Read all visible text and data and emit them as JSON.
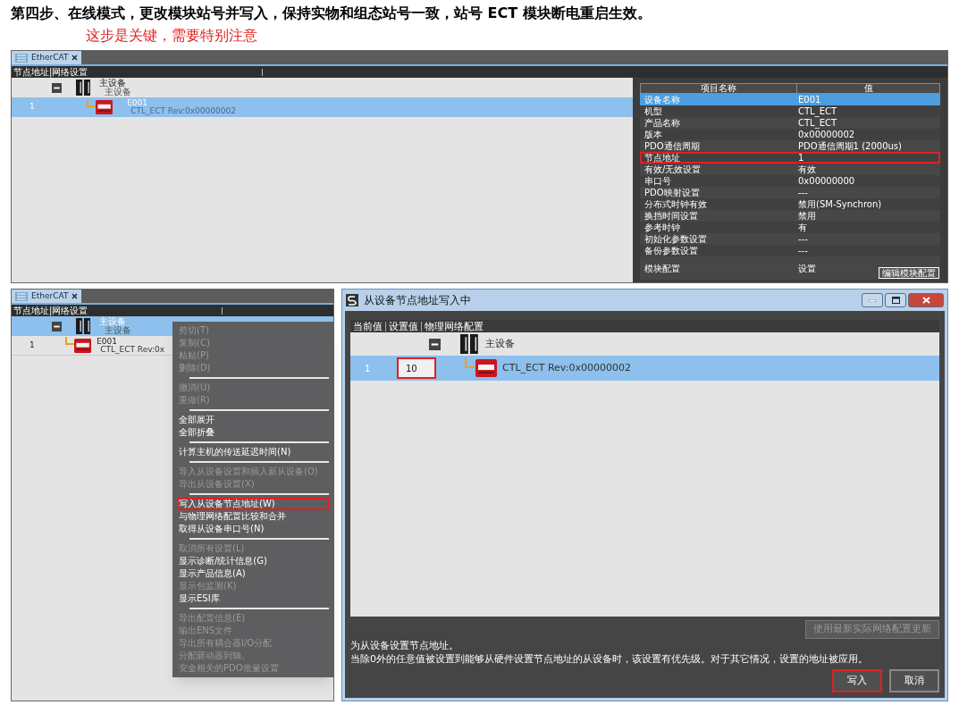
{
  "heading": {
    "title": "第四步、在线模式，更改模块站号并写入，保持实物和组态站号一致，站号 ECT 模块断电重启生效。",
    "note": "这步是关键，需要特别注意"
  },
  "top_screen": {
    "tab": "EtherCAT",
    "header": "节点地址|网络设置",
    "master": {
      "name": "主设备",
      "subtitle": "主设备",
      "selected": false
    },
    "slave": {
      "number": "1",
      "name": "E001",
      "model": "CTL_ECT Rev:0x00000002",
      "selected": true
    },
    "properties": {
      "columns": [
        "项目名称",
        "值"
      ],
      "rows": [
        {
          "name": "设备名称",
          "value": "E001",
          "selected": true,
          "marked": false
        },
        {
          "name": "机型",
          "value": "CTL_ECT",
          "selected": false,
          "marked": false
        },
        {
          "name": "产品名称",
          "value": "CTL_ECT",
          "selected": false,
          "marked": false
        },
        {
          "name": "版本",
          "value": "0x00000002",
          "selected": false,
          "marked": false
        },
        {
          "name": "PDO通信周期",
          "value": "PDO通信周期1 (2000us)",
          "selected": false,
          "marked": false
        },
        {
          "name": "节点地址",
          "value": "1",
          "selected": false,
          "marked": true
        },
        {
          "name": "有效/无效设置",
          "value": "有效",
          "selected": false,
          "marked": false
        },
        {
          "name": "串口号",
          "value": "0x00000000",
          "selected": false,
          "marked": false
        },
        {
          "name": "PDO映射设置",
          "value": "---",
          "selected": false,
          "marked": false
        },
        {
          "name": "分布式时钟有效",
          "value": "禁用(SM-Synchron)",
          "selected": false,
          "marked": false
        },
        {
          "name": "换挡时间设置",
          "value": "禁用",
          "selected": false,
          "marked": false
        },
        {
          "name": "参考时钟",
          "value": "有",
          "selected": false,
          "marked": false
        },
        {
          "name": "初始化参数设置",
          "value": "---",
          "selected": false,
          "marked": false
        },
        {
          "name": "备份参数设置",
          "value": "---",
          "selected": false,
          "marked": false
        },
        {
          "name": "模块配置",
          "value": "设置",
          "selected": false,
          "marked": false
        }
      ],
      "button": "编辑模块配置"
    }
  },
  "bottom_screen": {
    "tab": "EtherCAT",
    "header": "节点地址|网络设置",
    "master": {
      "name": "主设备",
      "subtitle": "主设备",
      "selected": true
    },
    "slave": {
      "number": "1",
      "name": "E001",
      "model": "CTL_ECT Rev:0x",
      "selected": false
    },
    "context_menu": [
      {
        "kind": "item",
        "label": "剪切(T)",
        "disabled": true,
        "marked": false
      },
      {
        "kind": "item",
        "label": "复制(C)",
        "disabled": true,
        "marked": false
      },
      {
        "kind": "item",
        "label": "粘贴(P)",
        "disabled": true,
        "marked": false
      },
      {
        "kind": "item",
        "label": "删除(D)",
        "disabled": true,
        "marked": false
      },
      {
        "kind": "separator"
      },
      {
        "kind": "item",
        "label": "撤消(U)",
        "disabled": true,
        "marked": false
      },
      {
        "kind": "item",
        "label": "重做(R)",
        "disabled": true,
        "marked": false
      },
      {
        "kind": "separator"
      },
      {
        "kind": "item",
        "label": "全部展开",
        "disabled": false,
        "marked": false
      },
      {
        "kind": "item",
        "label": "全部折叠",
        "disabled": false,
        "marked": false
      },
      {
        "kind": "separator"
      },
      {
        "kind": "item",
        "label": "计算主机的传送延迟时间(N)",
        "disabled": false,
        "marked": false
      },
      {
        "kind": "separator"
      },
      {
        "kind": "item",
        "label": "导入从设备设置和插入新从设备(O)",
        "disabled": true,
        "marked": false
      },
      {
        "kind": "item",
        "label": "导出从设备设置(X)",
        "disabled": true,
        "marked": false
      },
      {
        "kind": "separator"
      },
      {
        "kind": "item",
        "label": "写入从设备节点地址(W)",
        "disabled": false,
        "marked": true
      },
      {
        "kind": "item",
        "label": "与物理网络配置比较和合并",
        "disabled": false,
        "marked": false
      },
      {
        "kind": "item",
        "label": "取得从设备串口号(N)",
        "disabled": false,
        "marked": false
      },
      {
        "kind": "separator"
      },
      {
        "kind": "item",
        "label": "取消所有设置(L)",
        "disabled": true,
        "marked": false
      },
      {
        "kind": "item",
        "label": "显示诊断/统计信息(G)",
        "disabled": false,
        "marked": false
      },
      {
        "kind": "item",
        "label": "显示产品信息(A)",
        "disabled": false,
        "marked": false
      },
      {
        "kind": "item",
        "label": "显示包监测(K)",
        "disabled": true,
        "marked": false
      },
      {
        "kind": "item",
        "label": "显示ESI库",
        "disabled": false,
        "marked": false
      },
      {
        "kind": "separator"
      },
      {
        "kind": "item",
        "label": "导出配置信息(E)",
        "disabled": true,
        "marked": false
      },
      {
        "kind": "item",
        "label": "输出ENS文件",
        "disabled": true,
        "marked": false
      },
      {
        "kind": "item",
        "label": "导出所有耦合器I/O分配",
        "disabled": true,
        "marked": false
      },
      {
        "kind": "item",
        "label": "分配驱动器到轴。",
        "disabled": true,
        "marked": false
      },
      {
        "kind": "item",
        "label": "安全相关的PDO批量设置",
        "disabled": true,
        "marked": false
      }
    ]
  },
  "dialog": {
    "title": "从设备节点地址写入中",
    "columns": [
      "当前值",
      "设置值",
      "物理网络配置"
    ],
    "master": {
      "name": "主设备"
    },
    "slave": {
      "number": "1",
      "value": "10",
      "model": "CTL_ECT Rev:0x00000002",
      "selected": true,
      "marked": true
    },
    "update_button": {
      "label": "使用最新实际网络配置更新",
      "disabled": true
    },
    "description": [
      "为从设备设置节点地址。",
      "当除0外的任意值被设置到能够从硬件设置节点地址的从设备时，该设置有优先级。对于其它情况，设置的地址被应用。"
    ],
    "buttons": [
      {
        "label": "写入",
        "marked": true
      },
      {
        "label": "取消",
        "marked": false
      }
    ]
  }
}
